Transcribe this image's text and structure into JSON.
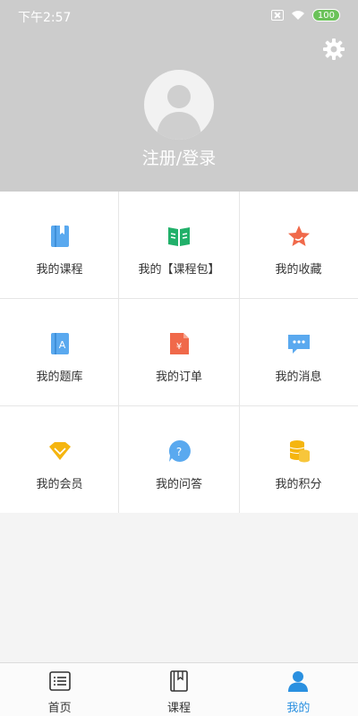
{
  "status_bar": {
    "time": "下午2:57",
    "battery": "100"
  },
  "header": {
    "login_label": "注册/登录"
  },
  "grid": {
    "items": [
      {
        "label": "我的课程",
        "icon": "book-icon"
      },
      {
        "label": "我的【课程包】",
        "icon": "open-book-icon"
      },
      {
        "label": "我的收藏",
        "icon": "star-icon"
      },
      {
        "label": "我的题库",
        "icon": "question-bank-icon"
      },
      {
        "label": "我的订单",
        "icon": "order-icon"
      },
      {
        "label": "我的消息",
        "icon": "message-icon"
      },
      {
        "label": "我的会员",
        "icon": "diamond-icon"
      },
      {
        "label": "我的问答",
        "icon": "qa-icon"
      },
      {
        "label": "我的积分",
        "icon": "coins-icon"
      }
    ]
  },
  "tabbar": {
    "tabs": [
      {
        "label": "首页",
        "icon": "home-list-icon",
        "active": false
      },
      {
        "label": "课程",
        "icon": "course-book-icon",
        "active": false
      },
      {
        "label": "我的",
        "icon": "person-icon",
        "active": true
      }
    ]
  },
  "colors": {
    "header_bg": "#cccccc",
    "active_tab": "#2a90e0",
    "battery": "#6ac259"
  }
}
